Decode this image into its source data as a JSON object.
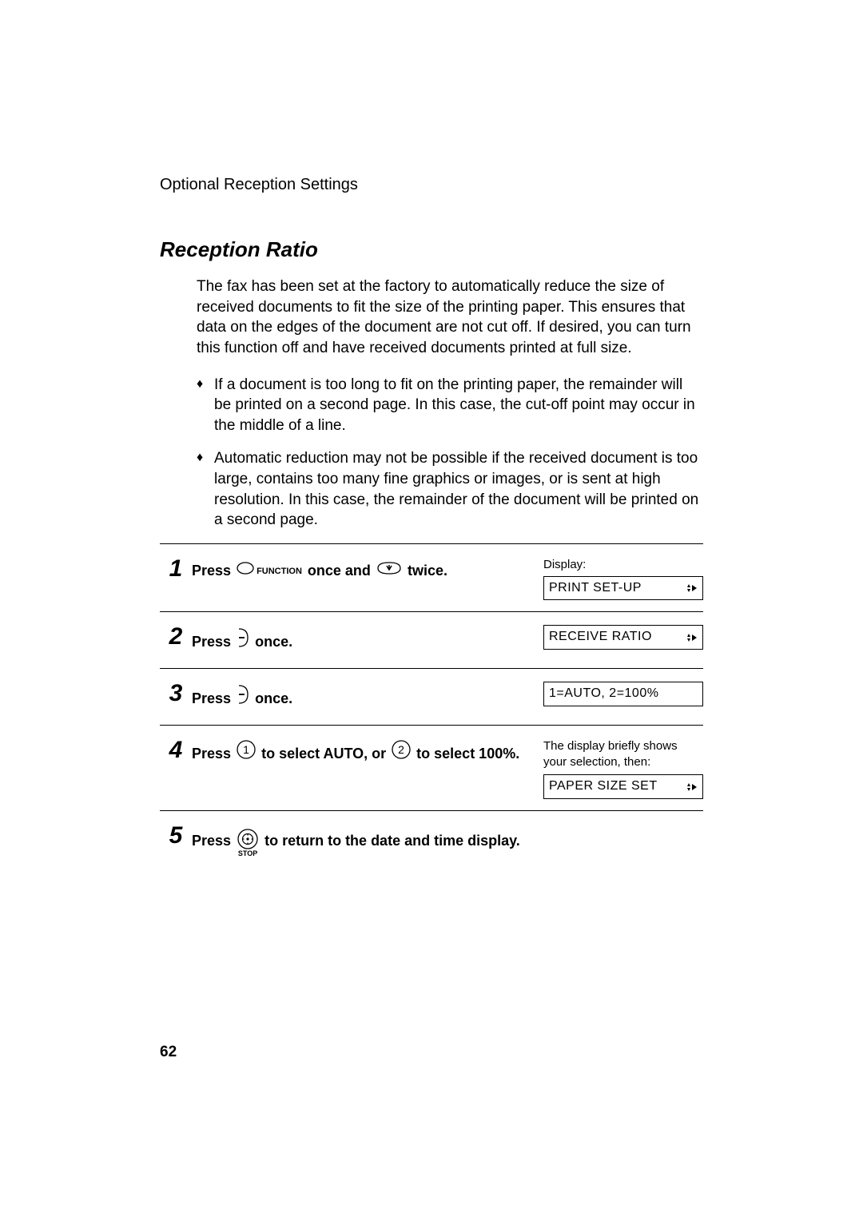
{
  "header": {
    "section": "Optional Reception Settings"
  },
  "title": "Reception Ratio",
  "intro": "The fax has been set at the factory to automatically reduce the size of received documents to fit the size of the printing paper. This ensures that data on the edges of the document are not cut off. If desired, you can turn this function off and have received documents printed at full size.",
  "bullets": [
    "If a document is too long to fit on the printing paper, the remainder will be printed on a second page. In this case, the cut-off point may occur in the middle of a line.",
    "Automatic reduction may not be possible if the received document is too large, contains too many fine graphics or images, or is sent at high resolution. In this case, the remainder of the document will be printed on a second page."
  ],
  "steps": {
    "s1": {
      "num": "1",
      "press": "Press",
      "function_label": "FUNCTION",
      "once_and": "once and",
      "twice": "twice.",
      "display_label": "Display:",
      "display_box": "PRINT SET-UP"
    },
    "s2": {
      "num": "2",
      "press": "Press",
      "once": "once.",
      "display_box": "RECEIVE RATIO"
    },
    "s3": {
      "num": "3",
      "press": "Press",
      "once": "once.",
      "display_box": "1=AUTO, 2=100%"
    },
    "s4": {
      "num": "4",
      "press": "Press",
      "to_select_auto_or": "to select AUTO, or",
      "to_select_100": "to select 100%.",
      "note": "The display briefly shows your selection, then:",
      "display_box": "PAPER SIZE SET"
    },
    "s5": {
      "num": "5",
      "press": "Press",
      "stop_label": "STOP",
      "tail": "to return to the date and time display."
    }
  },
  "page_number": "62"
}
